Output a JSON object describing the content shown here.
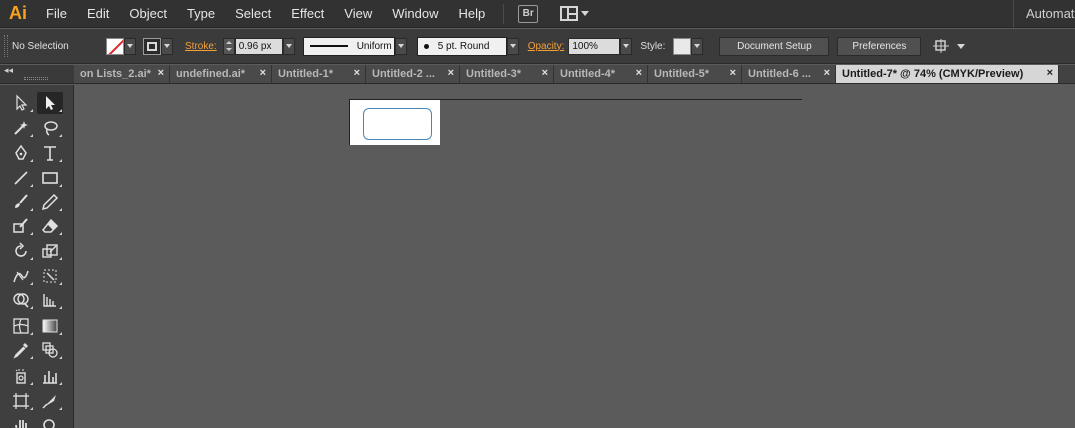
{
  "app": {
    "logo": "Ai",
    "menu": [
      "File",
      "Edit",
      "Object",
      "Type",
      "Select",
      "Effect",
      "View",
      "Window",
      "Help"
    ],
    "bridge_label": "Br",
    "workspace": "Automation"
  },
  "control": {
    "selection_status": "No Selection",
    "stroke_label": "Stroke:",
    "stroke_weight": "0.96 px",
    "profile": "Uniform",
    "brush": "5 pt. Round",
    "opacity_label": "Opacity:",
    "opacity": "100%",
    "style_label": "Style:",
    "document_setup": "Document Setup",
    "preferences": "Preferences"
  },
  "tabs": [
    {
      "label": "on Lists_2.ai*",
      "active": false
    },
    {
      "label": "undefined.ai*",
      "active": false
    },
    {
      "label": "Untitled-1*",
      "active": false
    },
    {
      "label": "Untitled-2 ...",
      "active": false
    },
    {
      "label": "Untitled-3*",
      "active": false
    },
    {
      "label": "Untitled-4*",
      "active": false
    },
    {
      "label": "Untitled-5*",
      "active": false
    },
    {
      "label": "Untitled-6 ...",
      "active": false
    },
    {
      "label": "Untitled-7* @ 74% (CMYK/Preview)",
      "active": true
    }
  ],
  "tab_close_glyph": "×",
  "panel_collapse_glyph": "◂◂",
  "colors": {
    "accent_orange": "#f7a31c",
    "label_orange": "#f2a03b",
    "canvas": "#5b5b5b",
    "rect_stroke": "#4a86b8",
    "no_fill_slash": "#e0262a"
  }
}
